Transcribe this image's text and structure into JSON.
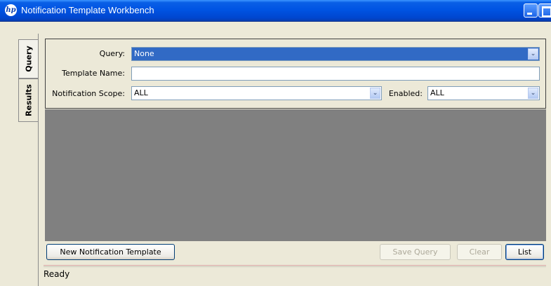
{
  "window": {
    "title": "Notification Template Workbench",
    "logo_text": "hp"
  },
  "tabs": [
    {
      "label": "Query",
      "selected": true
    },
    {
      "label": "Results",
      "selected": false
    }
  ],
  "query_form": {
    "query_label": "Query:",
    "query_value": "None",
    "template_name_label": "Template Name:",
    "template_name_value": "",
    "scope_label": "Notification Scope:",
    "scope_value": "ALL",
    "enabled_label": "Enabled:",
    "enabled_value": "ALL"
  },
  "buttons": {
    "new_template": "New Notification Template",
    "save_query": "Save Query",
    "clear": "Clear",
    "list": "List"
  },
  "status": {
    "text": "Ready"
  },
  "colors": {
    "titlebar": "#0054e3",
    "selection": "#316ac5",
    "results_area": "#808080"
  }
}
